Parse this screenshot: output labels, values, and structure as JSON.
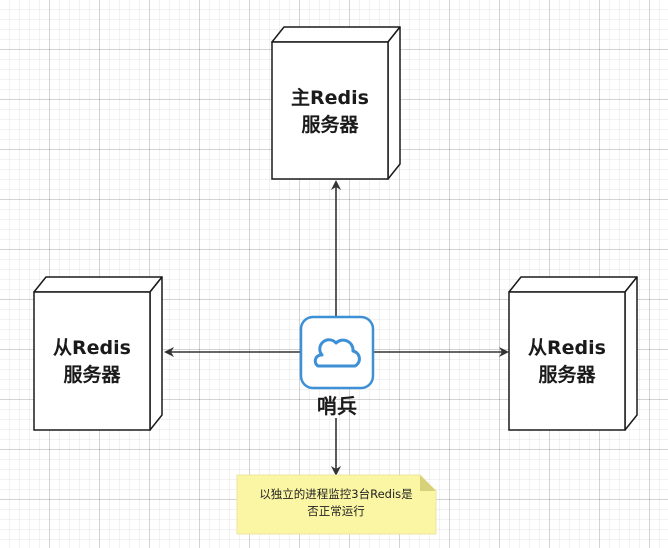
{
  "master": {
    "line1": "主Redis",
    "line2": "服务器"
  },
  "slave_left": {
    "line1": "从Redis",
    "line2": "服务器"
  },
  "slave_right": {
    "line1": "从Redis",
    "line2": "服务器"
  },
  "sentinel": {
    "label": "哨兵",
    "icon": "cloud-icon"
  },
  "note": {
    "line1": "以独立的进程监控3台Redis是",
    "line2": "否正常运行"
  },
  "colors": {
    "sentinel_border": "#3d8fd6",
    "note_fill": "#fbf6a3",
    "note_fold": "#d7d27a",
    "stroke": "#333333"
  }
}
